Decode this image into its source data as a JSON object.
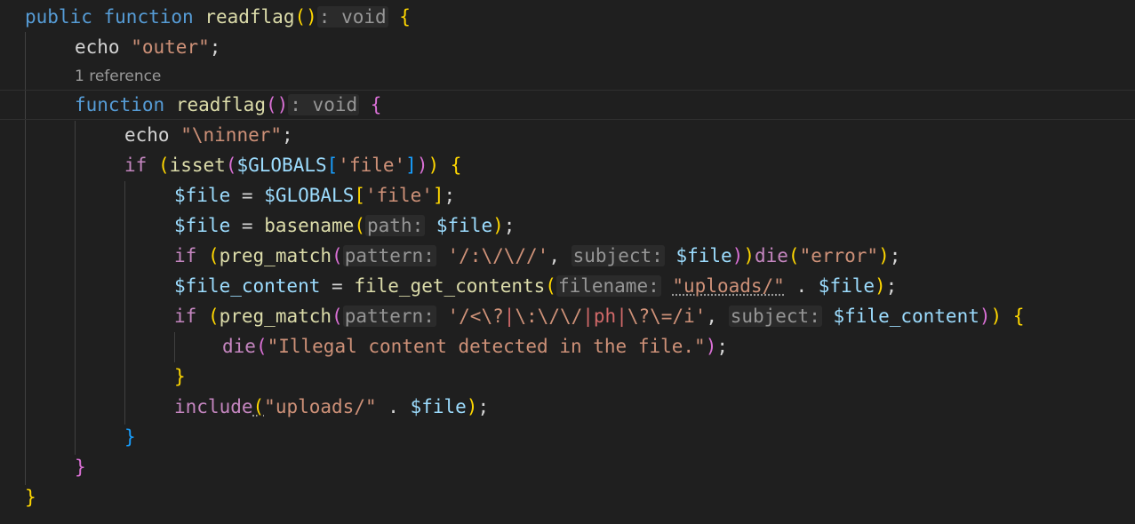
{
  "editor": {
    "codelens": "1 reference",
    "lines": [
      "public function readflag(): void {",
      "echo \"outer\";",
      "function readflag(): void {",
      "echo \"\\ninner\";",
      "if (isset($GLOBALS['file'])) {",
      "$file = $GLOBALS['file'];",
      "$file = basename(path: $file);",
      "if (preg_match(pattern: '/:\\/\\//', subject: $file))die(\"error\");",
      "$file_content = file_get_contents(filename: \"uploads/\" . $file);",
      "if (preg_match(pattern: '/<\\?|\\:\\/\\/|ph|\\?\\=/i', subject: $file_content)) {",
      "die(\"Illegal content detected in the file.\");",
      "}",
      "include(\"uploads/\" . $file);",
      "}",
      "}",
      "}"
    ],
    "tokens": {
      "public": "public",
      "function": "function",
      "readflag": "readflag",
      "void": ": void",
      "echo": "echo",
      "outer": "\"outer\"",
      "inner": "\"\\ninner\"",
      "if": "if",
      "isset": "isset",
      "globals": "$GLOBALS",
      "file_key": "'file'",
      "file_var": "$file",
      "basename": "basename",
      "hint_path": "path:",
      "preg_match": "preg_match",
      "hint_pattern": "pattern:",
      "regex1": "'/:\\/\\//'",
      "hint_subject": "subject:",
      "die": "die",
      "error_str": "\"error\"",
      "file_content": "$file_content",
      "file_get_contents": "file_get_contents",
      "hint_filename": "filename:",
      "uploads_str": "\"uploads/\"",
      "regex2_a": "'/<\\?",
      "regex2_pipe": "|",
      "regex2_b": "\\:\\/\\/",
      "regex2_c": "ph",
      "regex2_d": "\\?\\=/i'",
      "illegal_str": "\"Illegal content detected in the file.\"",
      "include": "include"
    }
  }
}
